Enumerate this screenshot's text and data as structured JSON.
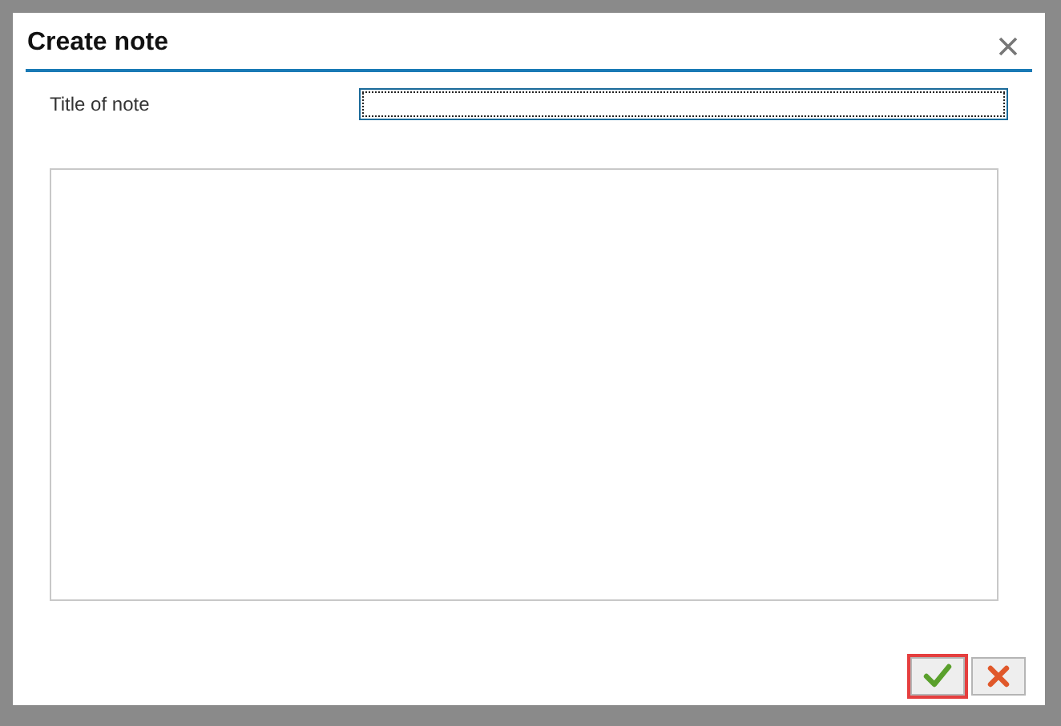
{
  "dialog": {
    "title": "Create note",
    "fields": [
      {
        "label": "Title of note",
        "kind": "text",
        "focused": true
      }
    ],
    "body": {
      "kind": "textarea"
    },
    "buttons": [
      {
        "kind": "confirm",
        "highlighted": true
      },
      {
        "kind": "cancel",
        "highlighted": false
      }
    ]
  }
}
